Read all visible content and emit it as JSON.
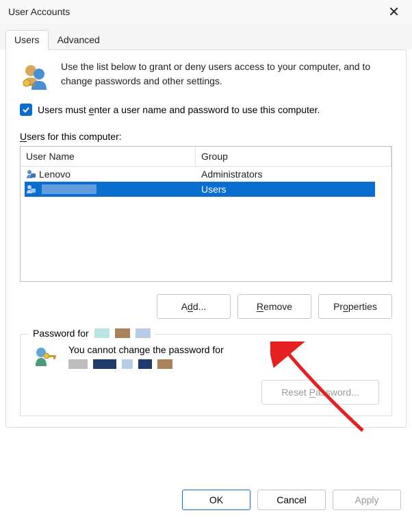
{
  "title": "User Accounts",
  "tabs": {
    "users": "Users",
    "advanced": "Advanced"
  },
  "intro": "Use the list below to grant or deny users access to your computer, and to change passwords and other settings.",
  "checkbox_label_pre": "Users must ",
  "checkbox_label_u": "e",
  "checkbox_label_post": "nter a user name and password to use this computer.",
  "users_label_pre": "U",
  "users_label_post": "sers for this computer:",
  "columns": {
    "name": "User Name",
    "group": "Group"
  },
  "rows": [
    {
      "name": "Lenovo",
      "group": "Administrators",
      "selected": false
    },
    {
      "name": "",
      "group": "Users",
      "selected": true
    }
  ],
  "buttons": {
    "add": "Add...",
    "remove": "Remove",
    "remove_u": "R",
    "properties": "Properties",
    "properties_u": "o"
  },
  "password_section": {
    "legend": "Password for",
    "text": "You cannot change the password for",
    "reset": "Reset Password...",
    "reset_u": "P"
  },
  "footer": {
    "ok": "OK",
    "cancel": "Cancel",
    "apply": "Apply"
  }
}
